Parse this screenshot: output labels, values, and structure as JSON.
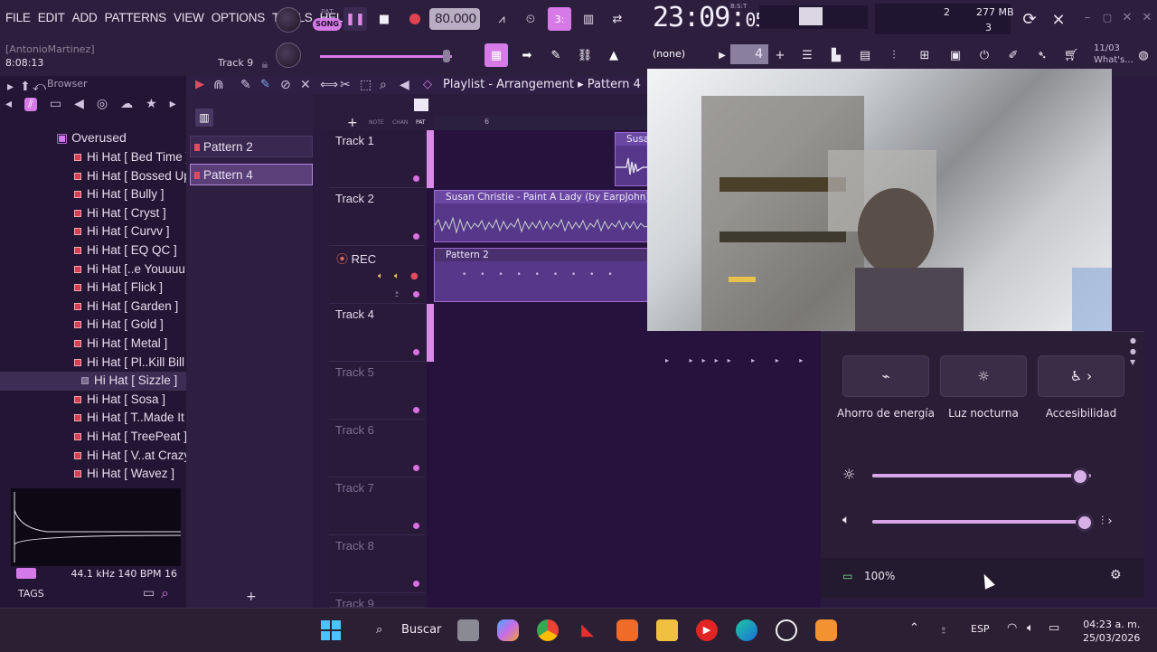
{
  "menu": [
    "FILE",
    "EDIT",
    "ADD",
    "PATTERNS",
    "VIEW",
    "OPTIONS",
    "TOOLS",
    "HELP"
  ],
  "transport": {
    "pat": "PAT",
    "song": "SONG",
    "bpm": "80.000"
  },
  "clock": {
    "main": "23:09",
    "sec": "05",
    "tz": "B:S:T"
  },
  "hint": {
    "user": "[AntonioMartinez]",
    "time": "8:08:13",
    "track": "Track 9"
  },
  "memory": {
    "cpu": "2",
    "ram": "277 MB",
    "voices": "3"
  },
  "snap": {
    "label": "(none)",
    "step": "4"
  },
  "news": {
    "date": "11/03",
    "text": "What's..."
  },
  "browser": {
    "title": "Browser",
    "folder": "Overused",
    "files": [
      "Hi Hat [ Bed Time ]",
      "Hi Hat [ Bossed Up ]",
      "Hi Hat [ Bully ]",
      "Hi Hat [ Cryst ]",
      "Hi Hat [ Curvv ]",
      "Hi Hat [ EQ QC ]",
      "Hi Hat [..e Youuuu ]",
      "Hi Hat [ Flick ]",
      "Hi Hat [ Garden ]",
      "Hi Hat [ Gold ]",
      "Hi Hat [ Metal ]",
      "Hi Hat [ Pl..Kill Bill ]",
      "Hi Hat [ Sizzle ]",
      "Hi Hat [ Sosa ]",
      "Hi Hat [ T..Made It ]",
      "Hi Hat [ TreePeat ]",
      "Hi Hat [ V..at Crazy ]",
      "Hi Hat [ Wavez ]"
    ],
    "selected_index": 12,
    "status": "44.1 kHz 140 BPM 16",
    "tags": "TAGS"
  },
  "patterns": [
    "Pattern 2",
    "Pattern 4"
  ],
  "playlist": {
    "title": "Playlist - Arrangement",
    "pattern": "Pattern 4",
    "ruler_mark": "6",
    "mini_labels": [
      "NOTE",
      "CHAN",
      "PAT"
    ],
    "tracks": [
      "Track 1",
      "Track 2",
      "REC",
      "Track 4",
      "Track 5",
      "Track 6",
      "Track 7",
      "Track 8",
      "Track 9"
    ],
    "clips": {
      "c1": "Susan",
      "c2": "Susan Christie - Paint A Lady (by EarpJohn)_3",
      "c3": "Pattern 2"
    }
  },
  "quick_settings": {
    "tiles": [
      "Ahorro de energía",
      "Luz nocturna",
      "Accesibilidad"
    ],
    "brightness": 0.95,
    "volume": 0.97,
    "battery": "100%"
  },
  "taskbar": {
    "search": "Buscar",
    "lang": "ESP",
    "time": "04:23 a. m.",
    "date": "25/03/2026"
  },
  "colors": {
    "accent": "#d67ae8",
    "bg": "#2a1a3d",
    "taskbar": "#2b1f34"
  }
}
